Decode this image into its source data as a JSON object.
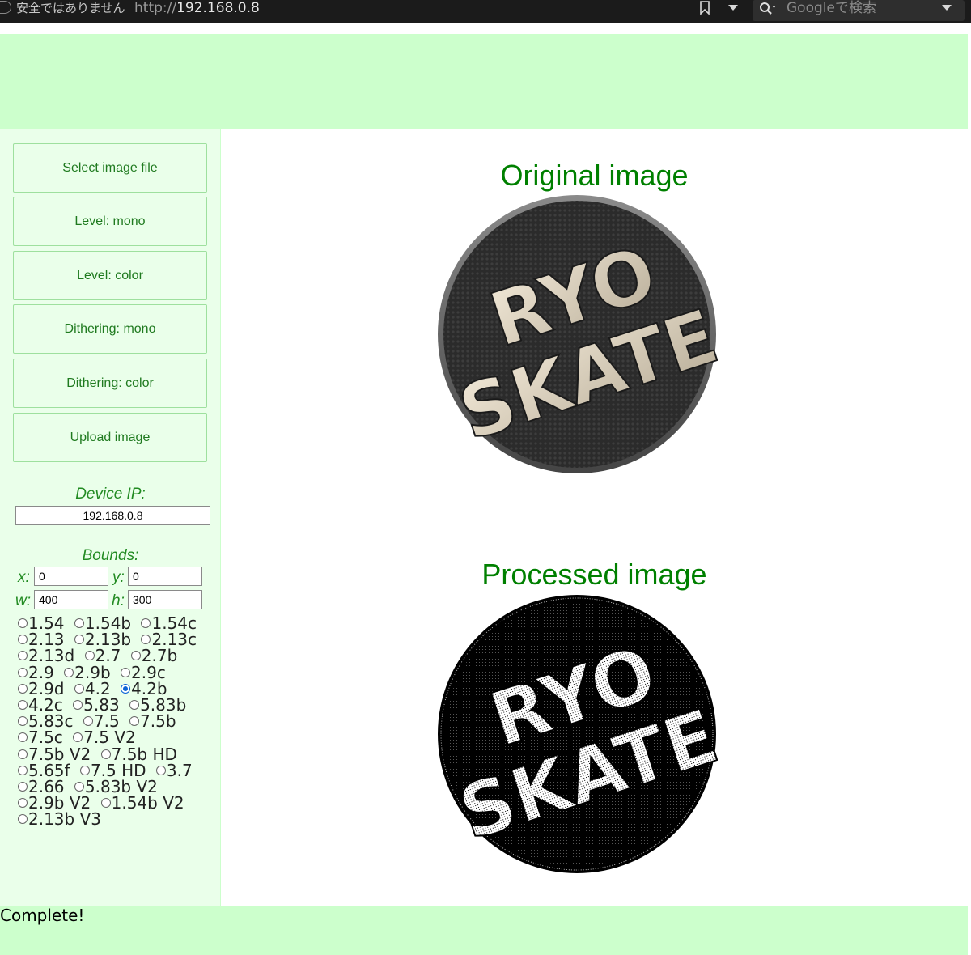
{
  "browser": {
    "security_text": "安全ではありません",
    "url_scheme": "http://",
    "url_host": "192.168.0.8",
    "search_placeholder": "Googleで検索"
  },
  "sidebar": {
    "buttons": [
      "Select image file",
      "Level: mono",
      "Level: color",
      "Dithering: mono",
      "Dithering: color",
      "Upload image"
    ],
    "device_ip_label": "Device IP:",
    "device_ip_value": "192.168.0.8",
    "bounds_label": "Bounds:",
    "bounds": {
      "x_label": "x:",
      "x_value": "0",
      "y_label": "y:",
      "y_value": "0",
      "w_label": "w:",
      "w_value": "400",
      "h_label": "h:",
      "h_value": "300"
    },
    "display_models": [
      "1.54",
      "1.54b",
      "1.54c",
      "2.13",
      "2.13b",
      "2.13c",
      "2.13d",
      "2.7",
      "2.7b",
      "2.9",
      "2.9b",
      "2.9c",
      "2.9d",
      "4.2",
      "4.2b",
      "4.2c",
      "5.83",
      "5.83b",
      "5.83c",
      "7.5",
      "7.5b",
      "7.5c",
      "7.5 V2",
      "7.5b V2",
      "7.5b HD",
      "5.65f",
      "7.5 HD",
      "3.7",
      "2.66",
      "5.83b V2",
      "2.9b V2",
      "1.54b V2",
      "2.13b V3"
    ],
    "selected_model": "4.2b"
  },
  "main": {
    "original_title": "Original image",
    "processed_title": "Processed image",
    "logo_line1": "RYO",
    "logo_line2": "SKATE"
  },
  "footer": {
    "status": "Complete!"
  },
  "colors": {
    "band": "#ccffcc",
    "sidebar": "#eaffea",
    "accent_text": "#008000"
  }
}
